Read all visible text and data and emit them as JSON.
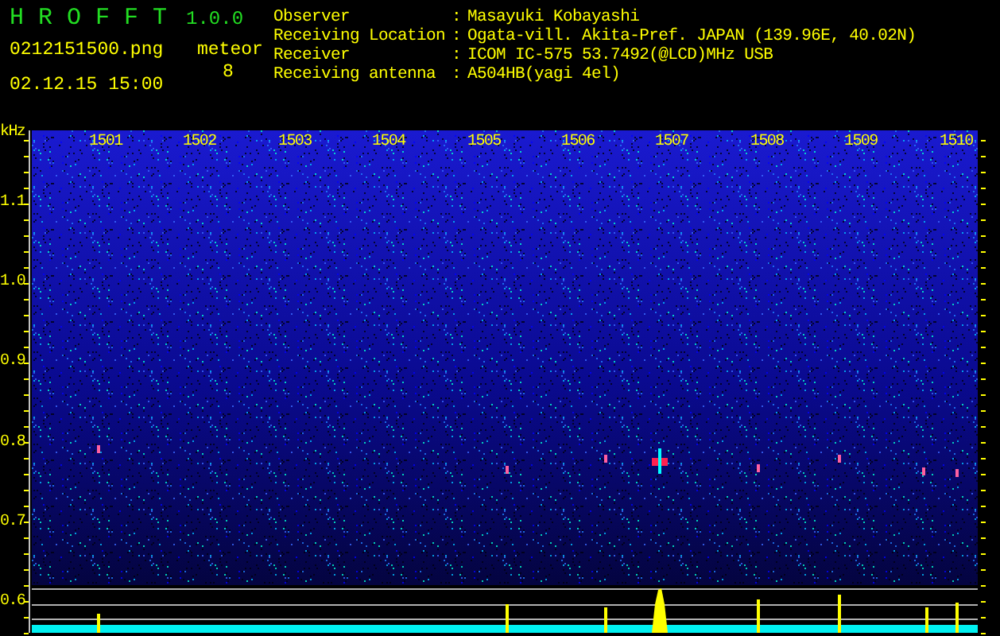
{
  "app": {
    "name": "H R O F F T",
    "version": "1.0.0"
  },
  "file": "0212151500.png",
  "datetime": "02.12.15 15:00",
  "meteor": {
    "label": "meteor",
    "count": "8"
  },
  "info": [
    {
      "label": "Observer",
      "separator": ":",
      "value": "Masayuki Kobayashi"
    },
    {
      "label": "Receiving Location",
      "separator": ":",
      "value": "Ogata-vill. Akita-Pref. JAPAN (139.96E, 40.02N)"
    },
    {
      "label": "Receiver",
      "separator": ":",
      "value": "ICOM IC-575 53.7492(@LCD)MHz USB"
    },
    {
      "label": "Receiving antenna",
      "separator": ":",
      "value": "A504HB(yagi 4el)"
    }
  ],
  "plot": {
    "y_unit": "kHz",
    "x_labels": [
      "1501",
      "1502",
      "1503",
      "1504",
      "1505",
      "1506",
      "1507",
      "1508",
      "1509",
      "1510"
    ],
    "y_labels": [
      "1.1",
      "1.0",
      "0.9",
      "0.8",
      "0.7",
      "0.6"
    ]
  }
}
